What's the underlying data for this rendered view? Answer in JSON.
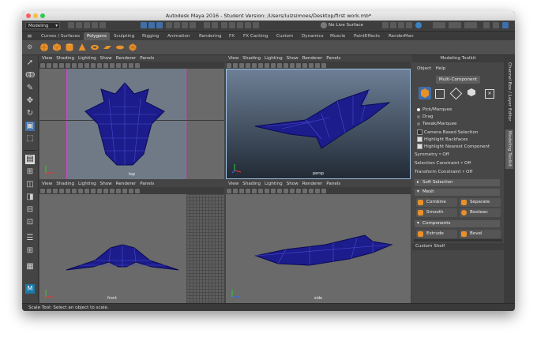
{
  "window": {
    "title": "Autodesk Maya 2016 - Student Version: /Users/luizsimoes/Desktop/first work.mb*",
    "traffic_colors": [
      "#fc605c",
      "#fdbc40",
      "#34c84a"
    ]
  },
  "statusline": {
    "mode": "Modeling",
    "live_surface": "No Live Surface"
  },
  "shelf": {
    "tabs": [
      "Curves / Surfaces",
      "Polygons",
      "Sculpting",
      "Rigging",
      "Animation",
      "Rendering",
      "FX",
      "FX Caching",
      "Custom",
      "Dynamics",
      "Muscle",
      "PaintEffects",
      "RenderMan"
    ],
    "active_tab": "Polygons"
  },
  "viewport_menu": [
    "View",
    "Shading",
    "Lighting",
    "Show",
    "Renderer",
    "Panels"
  ],
  "viewports": {
    "top": "top",
    "persp": "persp",
    "front": "front",
    "side": "side"
  },
  "toolkit": {
    "title": "Modeling Toolkit",
    "menu_object": "Object",
    "menu_help": "Help",
    "multi_component": "Multi-Component",
    "pick_marquee": "Pick/Marquee",
    "drag": "Drag",
    "tweak_marquee": "Tweak/Marquee",
    "camera_based": "Camera Based Selection",
    "highlight_backfaces": "Highlight Backfaces",
    "highlight_nearest": "Highlight Nearest Component",
    "symmetry_label": "Symmetry",
    "symmetry_value": "Off",
    "selection_constraint_label": "Selection Constraint",
    "selection_constraint_value": "Off",
    "transform_constraint_label": "Transform Constraint",
    "transform_constraint_value": "Off",
    "soft_selection": "Soft Selection",
    "mesh": "Mesh",
    "combine": "Combine",
    "separate": "Separate",
    "smooth": "Smooth",
    "boolean": "Boolean",
    "components": "Components",
    "extrude": "Extrude",
    "bevel": "Bevel",
    "custom_shelf": "Custom Shelf"
  },
  "side_tabs": {
    "channel_box": "Channel Box / Layer Editor",
    "modeling_toolkit": "Modeling Toolkit"
  },
  "help_line": "Scale Tool: Select an object to scale."
}
